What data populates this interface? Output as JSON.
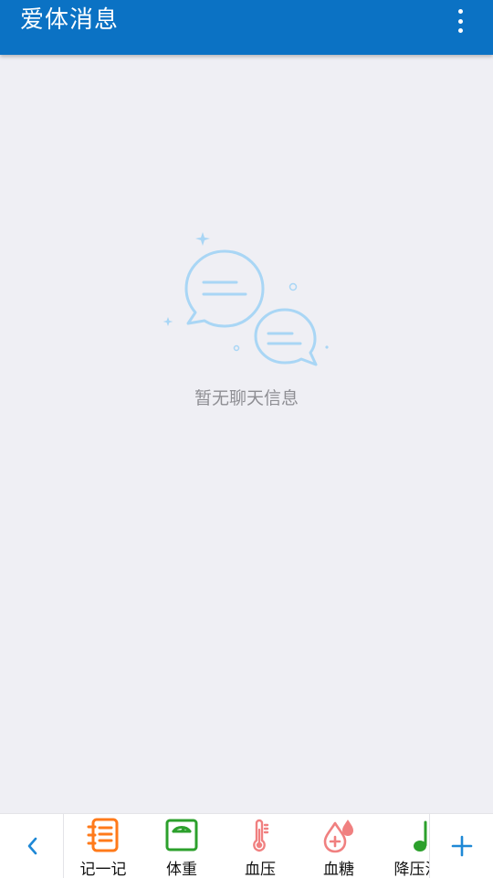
{
  "header": {
    "title": "爱体消息",
    "menu_icon": "more-vert-icon"
  },
  "empty_state": {
    "icon": "chat-bubbles-icon",
    "message": "暂无聊天信息"
  },
  "bottom_bar": {
    "left_icon": "chevron-left-icon",
    "right_icon": "plus-icon",
    "items": [
      {
        "label": "记一记",
        "icon": "notebook-icon",
        "color": "#ff7a1a"
      },
      {
        "label": "体重",
        "icon": "scale-icon",
        "color": "#2ca02c"
      },
      {
        "label": "血压",
        "icon": "thermometer-icon",
        "color": "#f08080"
      },
      {
        "label": "血糖",
        "icon": "blood-drop-icon",
        "color": "#f08080"
      },
      {
        "label": "降压治",
        "icon": "music-note-icon",
        "color": "#2ca02c"
      }
    ]
  },
  "colors": {
    "accent": "#0b72c4",
    "background": "#efeff4",
    "bubble": "#a9d6f5"
  }
}
